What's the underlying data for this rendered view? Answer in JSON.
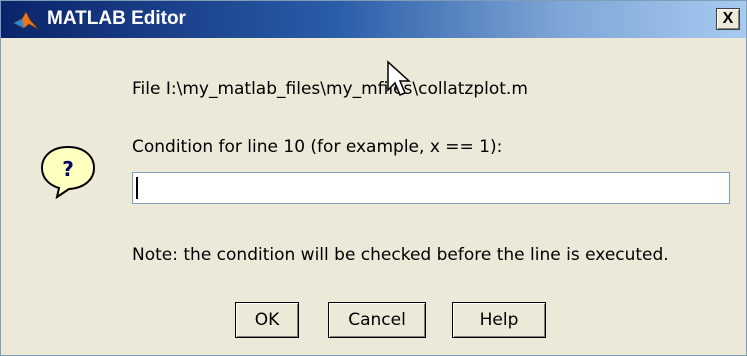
{
  "window": {
    "title": "MATLAB Editor",
    "close_label": "X"
  },
  "dialog": {
    "file_line": "File I:\\my_matlab_files\\my_mfiles\\collatzplot.m",
    "prompt": "Condition for line 10 (for example, x == 1):",
    "condition_value": "",
    "note": "Note: the condition will be checked before the line is executed.",
    "question_glyph": "?"
  },
  "buttons": {
    "ok": "OK",
    "cancel": "Cancel",
    "help": "Help"
  },
  "icons": {
    "app": "matlab-logo-icon",
    "question": "question-bubble-icon",
    "pointer": "mouse-pointer-icon"
  },
  "colors": {
    "titlebar_start": "#0a246a",
    "titlebar_end": "#a6caf0",
    "dialog_bg": "#ece9d8",
    "question_fill": "#ffffc0"
  }
}
